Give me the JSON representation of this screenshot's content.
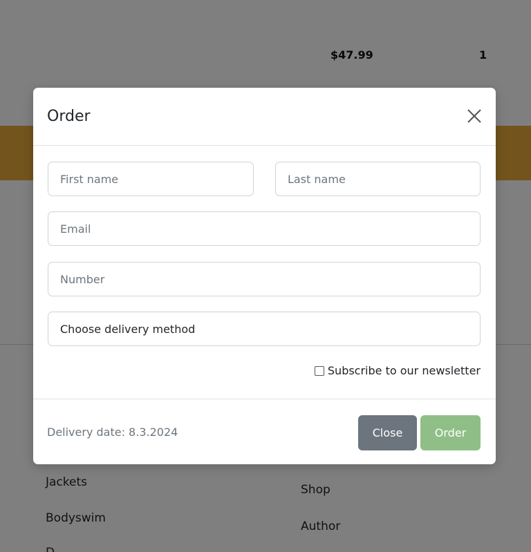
{
  "background": {
    "price": "$47.99",
    "quantity": "1",
    "links_left": [
      "Jackets",
      "Bodyswim",
      "D"
    ],
    "links_right": [
      "Shop",
      "Author"
    ],
    "band_color": "#e7a93a"
  },
  "modal": {
    "title": "Order",
    "fields": {
      "first_name_placeholder": "First name",
      "last_name_placeholder": "Last name",
      "email_placeholder": "Email",
      "number_placeholder": "Number",
      "delivery_method": "Choose delivery method"
    },
    "newsletter_label": "Subscribe to our newsletter",
    "delivery_date": "Delivery date: 8.3.2024",
    "close_label": "Close",
    "order_label": "Order"
  },
  "colors": {
    "close_button": "#6c757d",
    "order_button": "#8fbf86"
  },
  "icons": {
    "close": "close-icon"
  }
}
